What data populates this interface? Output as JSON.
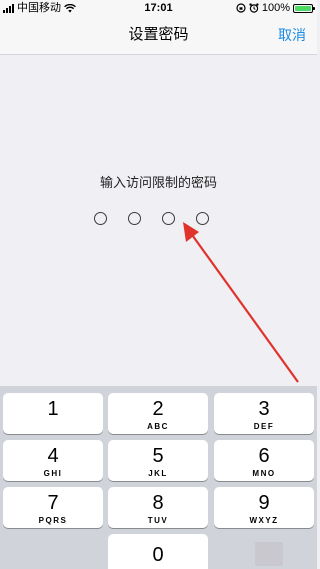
{
  "status_bar": {
    "carrier": "中国移动",
    "time": "17:01",
    "battery": "100%",
    "battery_color": "#4cd964"
  },
  "nav": {
    "title": "设置密码",
    "cancel_label": "取消",
    "accent_color": "#1a8ae3"
  },
  "prompt": "输入访问限制的密码",
  "passcode_length": 4,
  "keypad": {
    "keys": [
      {
        "num": "1",
        "letters": ""
      },
      {
        "num": "2",
        "letters": "ABC"
      },
      {
        "num": "3",
        "letters": "DEF"
      },
      {
        "num": "4",
        "letters": "GHI"
      },
      {
        "num": "5",
        "letters": "JKL"
      },
      {
        "num": "6",
        "letters": "MNO"
      },
      {
        "num": "7",
        "letters": "PQRS"
      },
      {
        "num": "8",
        "letters": "TUV"
      },
      {
        "num": "9",
        "letters": "WXYZ"
      },
      {
        "num": "0",
        "letters": ""
      }
    ]
  },
  "annotation_color": "#e0332b"
}
